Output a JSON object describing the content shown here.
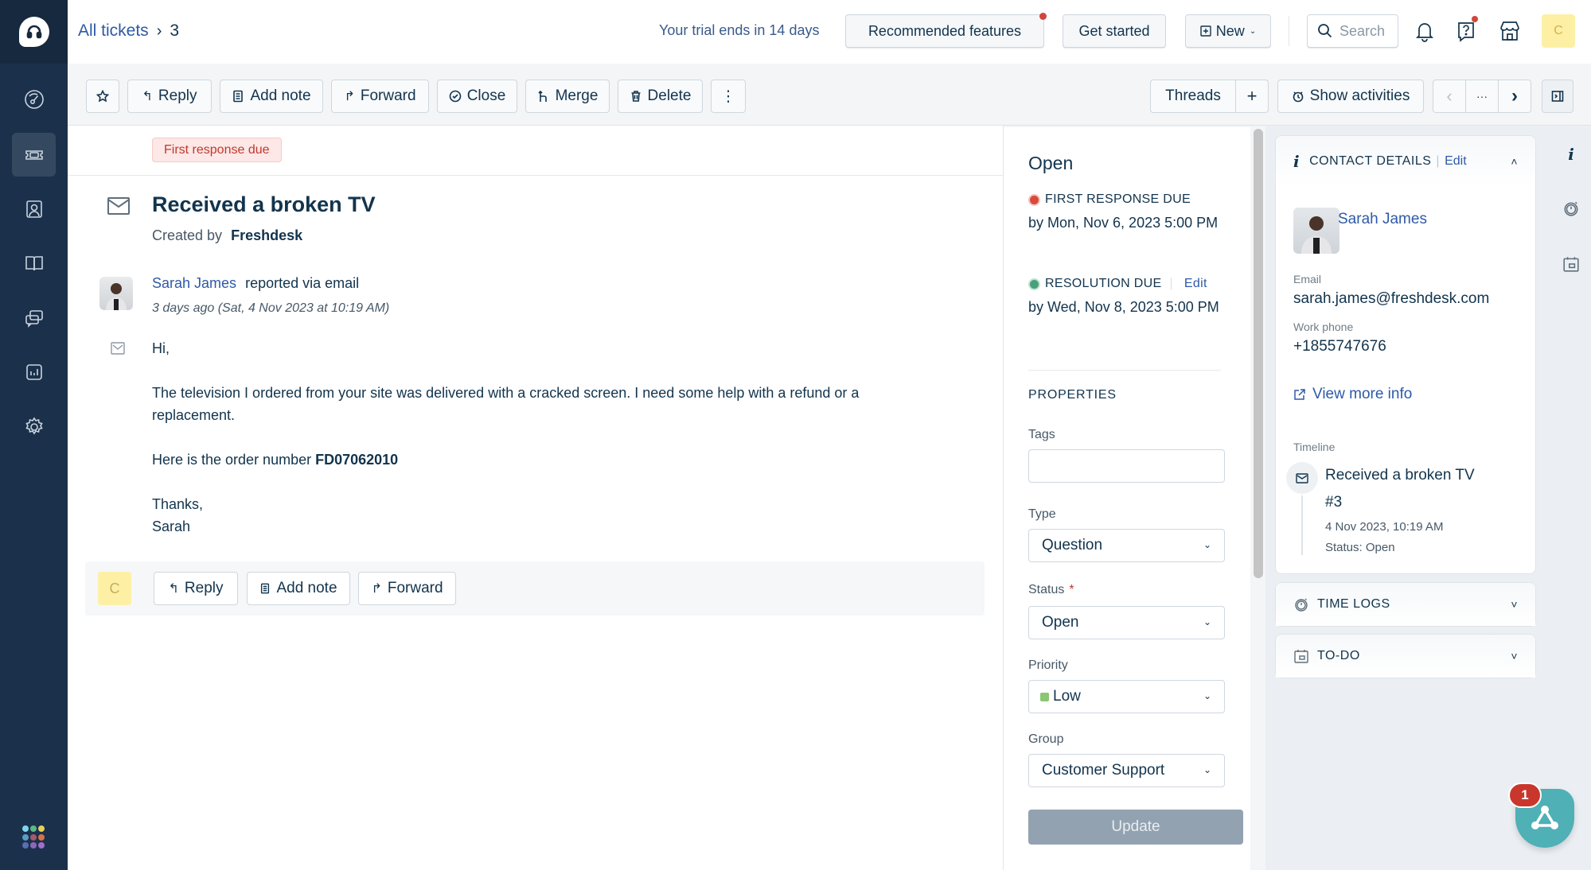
{
  "nav": {
    "items": [
      {
        "name": "dashboard",
        "icon": "dashboard-icon"
      },
      {
        "name": "tickets",
        "icon": "ticket-icon",
        "active": true
      },
      {
        "name": "contacts",
        "icon": "contact-icon"
      },
      {
        "name": "solutions",
        "icon": "book-icon"
      },
      {
        "name": "discussions",
        "icon": "chat-icon"
      },
      {
        "name": "reports",
        "icon": "reports-icon"
      },
      {
        "name": "admin",
        "icon": "gear-icon"
      }
    ],
    "apps_dot_colors": [
      "#7fd4ec",
      "#5cb88a",
      "#e9cf58",
      "#5b9bc9",
      "#a35a6a",
      "#d0744c",
      "#5b6db2",
      "#8a68b9",
      "#a06ec9"
    ]
  },
  "header": {
    "breadcrumb_root": "All tickets",
    "breadcrumb_separator": "›",
    "breadcrumb_current": "3",
    "trial_text": "Your trial ends in 14 days",
    "recommended_label": "Recommended features",
    "get_started_label": "Get started",
    "new_label": "New",
    "search_placeholder": "Search",
    "avatar_initial": "C"
  },
  "toolbar": {
    "reply": "Reply",
    "add_note": "Add note",
    "forward": "Forward",
    "close": "Close",
    "merge": "Merge",
    "delete": "Delete",
    "more": "⋮",
    "threads": "Threads",
    "plus": "+",
    "show_activities": "Show activities",
    "prev": "‹",
    "ellipsis": "···",
    "next": "›"
  },
  "ticket": {
    "badge": "First response due",
    "title": "Received a broken TV",
    "created_by_label": "Created by",
    "created_by": "Freshdesk",
    "requester": "Sarah James",
    "reported_via": "reported via email",
    "timestamp": "3 days ago (Sat, 4 Nov 2023 at 10:19 AM)",
    "body": {
      "greeting": "Hi,",
      "paragraph": "The television I ordered from your site was delivered with a cracked screen. I need some help with a refund or a replacement.",
      "order_prefix": "Here is the order number",
      "order_number": "FD07062010",
      "closing": "Thanks,",
      "signature": "Sarah"
    },
    "reply_bar": {
      "avatar_initial": "C",
      "reply": "Reply",
      "add_note": "Add note",
      "forward": "Forward"
    }
  },
  "properties": {
    "status_heading": "Open",
    "first_response_label": "FIRST RESPONSE DUE",
    "first_response_date": "by Mon, Nov 6, 2023 5:00 PM",
    "resolution_label": "RESOLUTION DUE",
    "resolution_edit": "Edit",
    "resolution_date": "by Wed, Nov 8, 2023 5:00 PM",
    "section_title": "PROPERTIES",
    "tags_label": "Tags",
    "tags_value": "",
    "type_label": "Type",
    "type_value": "Question",
    "status_label": "Status",
    "status_required": "*",
    "status_value": "Open",
    "priority_label": "Priority",
    "priority_value": "Low",
    "priority_color": "#8bc672",
    "group_label": "Group",
    "group_value": "Customer Support",
    "update_label": "Update"
  },
  "contact": {
    "header": "CONTACT DETAILS",
    "edit": "Edit",
    "name": "Sarah James",
    "email_label": "Email",
    "email": "sarah.james@freshdesk.com",
    "phone_label": "Work phone",
    "phone": "+1855747676",
    "view_more": "View more info",
    "timeline_label": "Timeline",
    "timeline_title": "Received a broken TV",
    "timeline_id": "#3",
    "timeline_date": "4 Nov 2023, 10:19 AM",
    "timeline_status": "Status: Open",
    "time_logs": "TIME LOGS",
    "todo": "TO-DO"
  },
  "bot": {
    "badge_count": "1"
  }
}
